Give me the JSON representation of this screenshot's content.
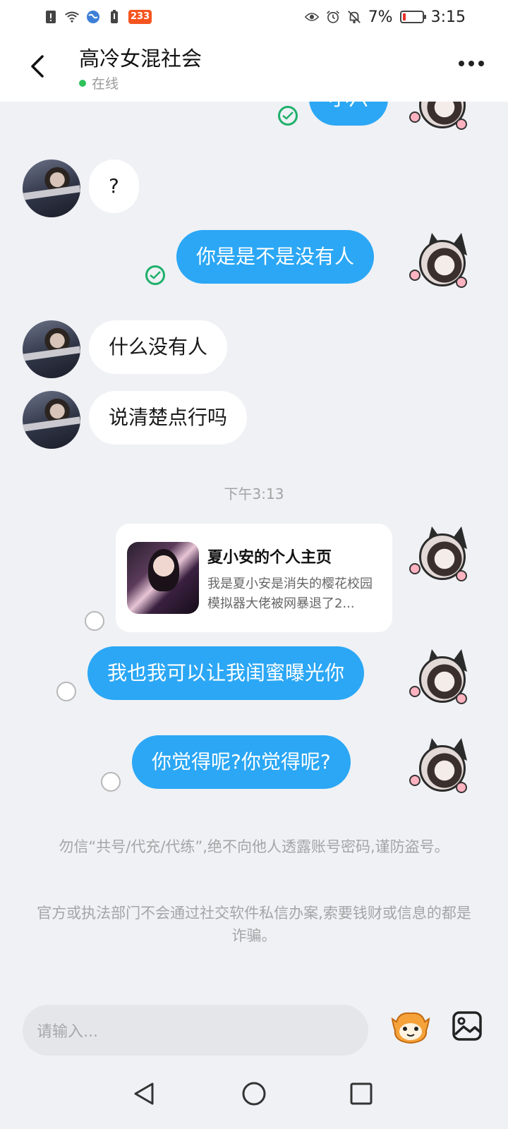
{
  "status_bar": {
    "app_badge": "233",
    "battery_percent": "7%",
    "time": "3:15"
  },
  "header": {
    "title": "高冷女混社会",
    "status": "在线"
  },
  "messages": [
    {
      "side": "out",
      "text": "小六",
      "status": "read"
    },
    {
      "side": "in",
      "text": "?"
    },
    {
      "side": "out",
      "text": "你是是不是没有人",
      "status": "read"
    },
    {
      "side": "in",
      "text": "什么没有人"
    },
    {
      "side": "in",
      "text": "说清楚点行吗"
    },
    {
      "side": "out",
      "text": "我也我可以让我闺蜜曝光你",
      "status": "unread"
    },
    {
      "side": "out",
      "text": "你觉得呢?你觉得呢?",
      "status": "unread"
    }
  ],
  "timestamp": "下午3:13",
  "profile_card": {
    "title": "夏小安的个人主页",
    "description": "我是夏小安是消失的樱花校园模拟器大佬被网暴退了2..."
  },
  "notices": [
    "勿信“共号/代充/代练”,绝不向他人透露账号密码,谨防盗号。",
    "官方或执法部门不会通过社交软件私信办案,索要钱财或信息的都是诈骗。"
  ],
  "input": {
    "placeholder": "请输入..."
  },
  "colors": {
    "bubble_out": "#2ba7f5",
    "bubble_in": "#ffffff",
    "read_check": "#1fb06b",
    "online": "#2fc15a"
  }
}
